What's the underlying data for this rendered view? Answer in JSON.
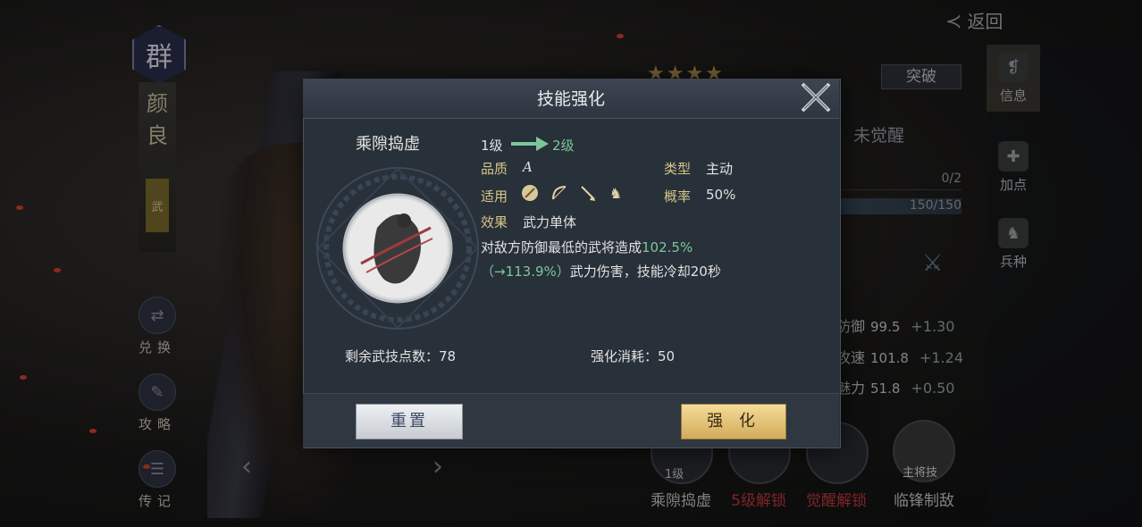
{
  "background": {
    "faction_char": "群",
    "general_name_chars": [
      "颜",
      "良"
    ],
    "general_tag": "武",
    "side_buttons": [
      {
        "label": "兑换",
        "icon": "exchange-icon"
      },
      {
        "label": "攻略",
        "icon": "guide-icon"
      },
      {
        "label": "传记",
        "icon": "biography-icon"
      }
    ],
    "back_label": "返回",
    "nav_items": [
      {
        "label": "信息",
        "icon": "scroll-icon",
        "active": true
      },
      {
        "label": "加点",
        "icon": "points-icon",
        "active": false
      },
      {
        "label": "兵种",
        "icon": "troop-icon",
        "active": false
      }
    ],
    "break_label": "突破",
    "awaken_status": "未觉醒",
    "bar1_value": "0/2",
    "bar2_value": "150/150",
    "stats": [
      {
        "name": "防御",
        "value": "99.5",
        "inc": "+1.30"
      },
      {
        "name": "攻速",
        "value": "101.8",
        "inc": "+1.24"
      },
      {
        "name": "魅力",
        "value": "51.8",
        "inc": "+0.50"
      }
    ],
    "skills": [
      {
        "label": "乘隙捣虚",
        "badge": "1级",
        "color": "#c8c8c8"
      },
      {
        "label": "5级解锁",
        "badge": "",
        "color": "#c0393b"
      },
      {
        "label": "觉醒解锁",
        "badge": "",
        "color": "#c0393b"
      },
      {
        "label": "临锋制敌",
        "badge": "主将技",
        "color": "#c8c8c8"
      }
    ]
  },
  "modal": {
    "title": "技能强化",
    "skill_name": "乘隙捣虚",
    "level_from": "1级",
    "level_to": "2级",
    "quality_label": "品质",
    "quality_value": "A",
    "type_label": "类型",
    "type_value": "主动",
    "apply_label": "适用",
    "apply_icons": [
      "shield-icon",
      "bow-icon",
      "spear-icon",
      "horse-icon"
    ],
    "chance_label": "概率",
    "chance_value": "50%",
    "effect_label": "效果",
    "effect_value": "武力单体",
    "desc_part1": "对敌方防御最低的武将造成",
    "desc_pct": "102.5%",
    "desc_next": "（→113.9%）",
    "desc_part2": "武力伤害，技能冷却20秒",
    "remaining_label": "剩余武技点数：",
    "remaining_value": "78",
    "cost_label": "强化消耗：",
    "cost_value": "50",
    "reset_label": "重置",
    "enhance_label": "强 化"
  }
}
